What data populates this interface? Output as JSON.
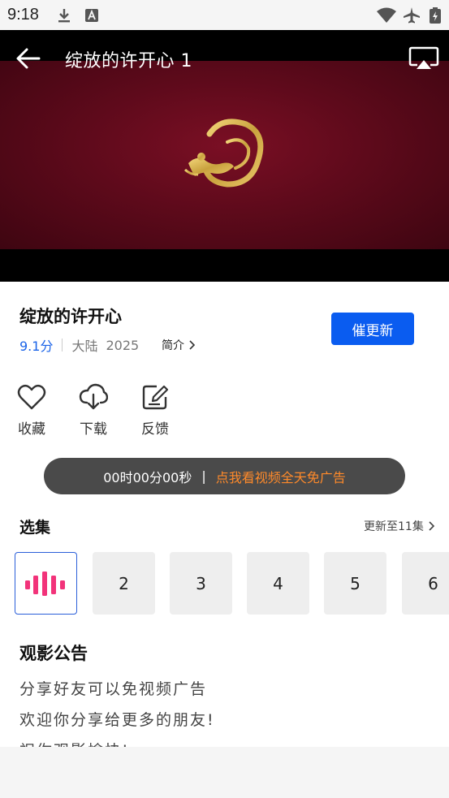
{
  "status_bar": {
    "time": "9:18",
    "icons": [
      "download-icon",
      "text-a-icon",
      "wifi-icon",
      "airplane-icon",
      "battery-charging-icon"
    ]
  },
  "player": {
    "title": "绽放的许开心 1",
    "back_icon": "back-arrow-icon",
    "cast_icon": "airplay-cast-icon",
    "logo_icon": "golden-flying-goddess-logo",
    "colors": {
      "frame": "#5e0a1b",
      "logo": "#d4b04a"
    }
  },
  "info": {
    "title": "绽放的许开心",
    "score": "9.1分",
    "region": "大陆",
    "year": "2025",
    "intro_label": "简介",
    "update_button": "催更新",
    "colors": {
      "score": "#1a63e8",
      "button": "#0a5cf0"
    }
  },
  "actions": [
    {
      "label": "收藏",
      "icon": "heart-icon"
    },
    {
      "label": "下载",
      "icon": "cloud-download-icon"
    },
    {
      "label": "反馈",
      "icon": "edit-feedback-icon"
    }
  ],
  "ad_banner": {
    "timer": "00时00分00秒",
    "separator": "|",
    "link": "点我看视频全天免广告",
    "colors": {
      "link": "#ff8a2a",
      "background": "#4a4a4a"
    }
  },
  "episodes": {
    "heading": "选集",
    "update_status": "更新至11集",
    "items": [
      {
        "label": "",
        "icon": "playing-bars-icon",
        "active": true
      },
      {
        "label": "2"
      },
      {
        "label": "3"
      },
      {
        "label": "4"
      },
      {
        "label": "5"
      },
      {
        "label": "6"
      }
    ]
  },
  "notice": {
    "heading": "观影公告",
    "lines": [
      "分享好友可以免视频广告",
      "欢迎你分享给更多的朋友!",
      "祝你观影愉快!"
    ]
  }
}
